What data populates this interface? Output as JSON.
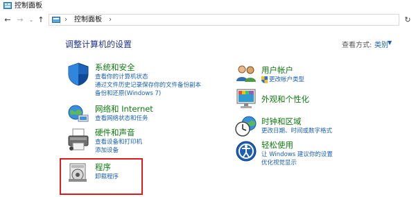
{
  "window": {
    "title": "控制面板",
    "icon": "control-panel-icon"
  },
  "nav": {
    "back_icon": "back-arrow-icon",
    "forward_icon": "forward-arrow-icon",
    "recent_icon": "chevron-down-icon",
    "up_icon": "up-arrow-icon",
    "refresh_icon": "refresh-icon"
  },
  "address": {
    "path": "控制面板"
  },
  "header": {
    "title": "调整计算机的设置",
    "view_by_label": "查看方式:",
    "view_by_value": "类别"
  },
  "categories_left": [
    {
      "title": "系统和安全",
      "icon": "shield-icon",
      "links": [
        "查看你的计算机状态",
        "通过文件历史记录保存你的文件备份副本",
        "备份和还原(Windows 7)"
      ]
    },
    {
      "title": "网络和 Internet",
      "icon": "network-globe-icon",
      "links": [
        "查看网络状态和任务"
      ]
    },
    {
      "title": "硬件和声音",
      "icon": "printer-icon",
      "links": [
        "查看设备和打印机",
        "添加设备"
      ]
    },
    {
      "title": "程序",
      "icon": "programs-icon",
      "links": [
        "卸载程序"
      ]
    }
  ],
  "categories_right": [
    {
      "title": "用户帐户",
      "icon": "users-icon",
      "links": [
        "更改帐户类型"
      ],
      "link_icon": "uac-shield-icon"
    },
    {
      "title": "外观和个性化",
      "icon": "appearance-icon",
      "links": []
    },
    {
      "title": "时钟和区域",
      "icon": "clock-globe-icon",
      "links": [
        "更改日期、时间或数字格式"
      ]
    },
    {
      "title": "轻松使用",
      "icon": "ease-of-access-icon",
      "links": [
        "让 Windows 建议你的设置",
        "优化视觉显示"
      ]
    }
  ],
  "colors": {
    "category_title": "#0e7a0e",
    "link": "#1a5fb4",
    "highlight_border": "#e0191f",
    "header_title": "#1e3287"
  }
}
